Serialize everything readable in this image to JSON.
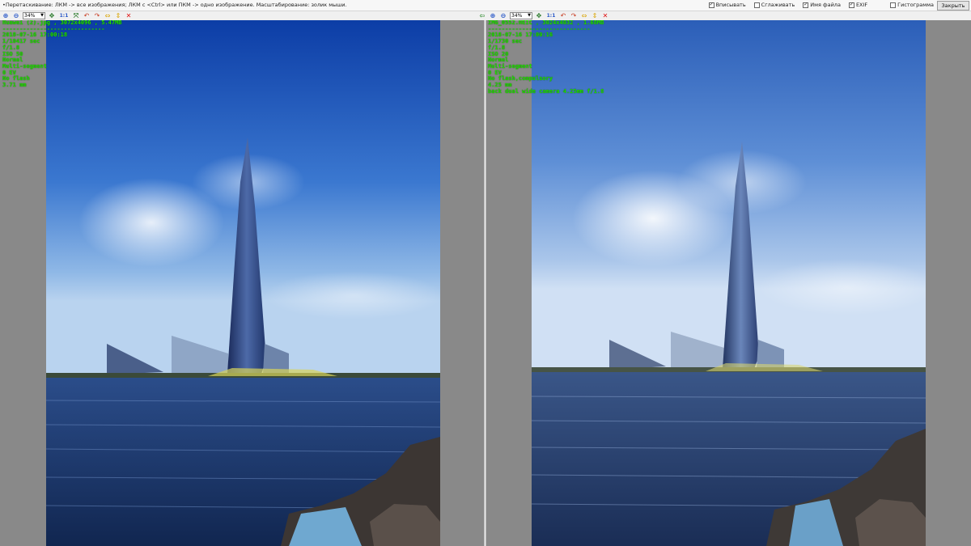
{
  "hint": "•Перетаскивание: ЛКМ -> все изображения; ЛКМ с <Ctrl> или ПКМ -> одно изображение. Масштабирование: золик мыши.",
  "options": [
    {
      "label": "Вписывать",
      "checked": true
    },
    {
      "label": "Сглаживать",
      "checked": false
    },
    {
      "label": "Имя файла",
      "checked": true
    },
    {
      "label": "EXIF",
      "checked": true
    },
    {
      "label": "Гистограмма",
      "checked": false
    }
  ],
  "close_label": "Закрыть",
  "zoom_left": "34%",
  "zoom_right": "34%",
  "one_to_one": "1:1",
  "left_exif": [
    "Huawei (2).jpg , 3072x4096 , 5.47MB",
    "------------------------------",
    "2018-07-16 17:00:18",
    "1/10417 sec",
    "f/1.8",
    "ISO 50",
    "Normal",
    "Multi-segment",
    "0 EV",
    "No flash",
    "3.71 mm"
  ],
  "right_exif": [
    "IMG_0552.HEIC , 3024x4032 , 1.68MB",
    "------------------------------",
    "2018-07-16 17:00:16",
    "1/1730 sec",
    "f/1.8",
    "ISO 20",
    "Normal",
    "Multi-segment",
    "0 EV",
    "No flash,compulsory",
    "4.25 mm",
    "back dual wide camera 4.25mm f/1.8"
  ],
  "colors": {
    "pane_bg": "#898989",
    "exif_text": "#22e000",
    "sky_top": "#0e3fa8",
    "water": "#1f3f78"
  }
}
